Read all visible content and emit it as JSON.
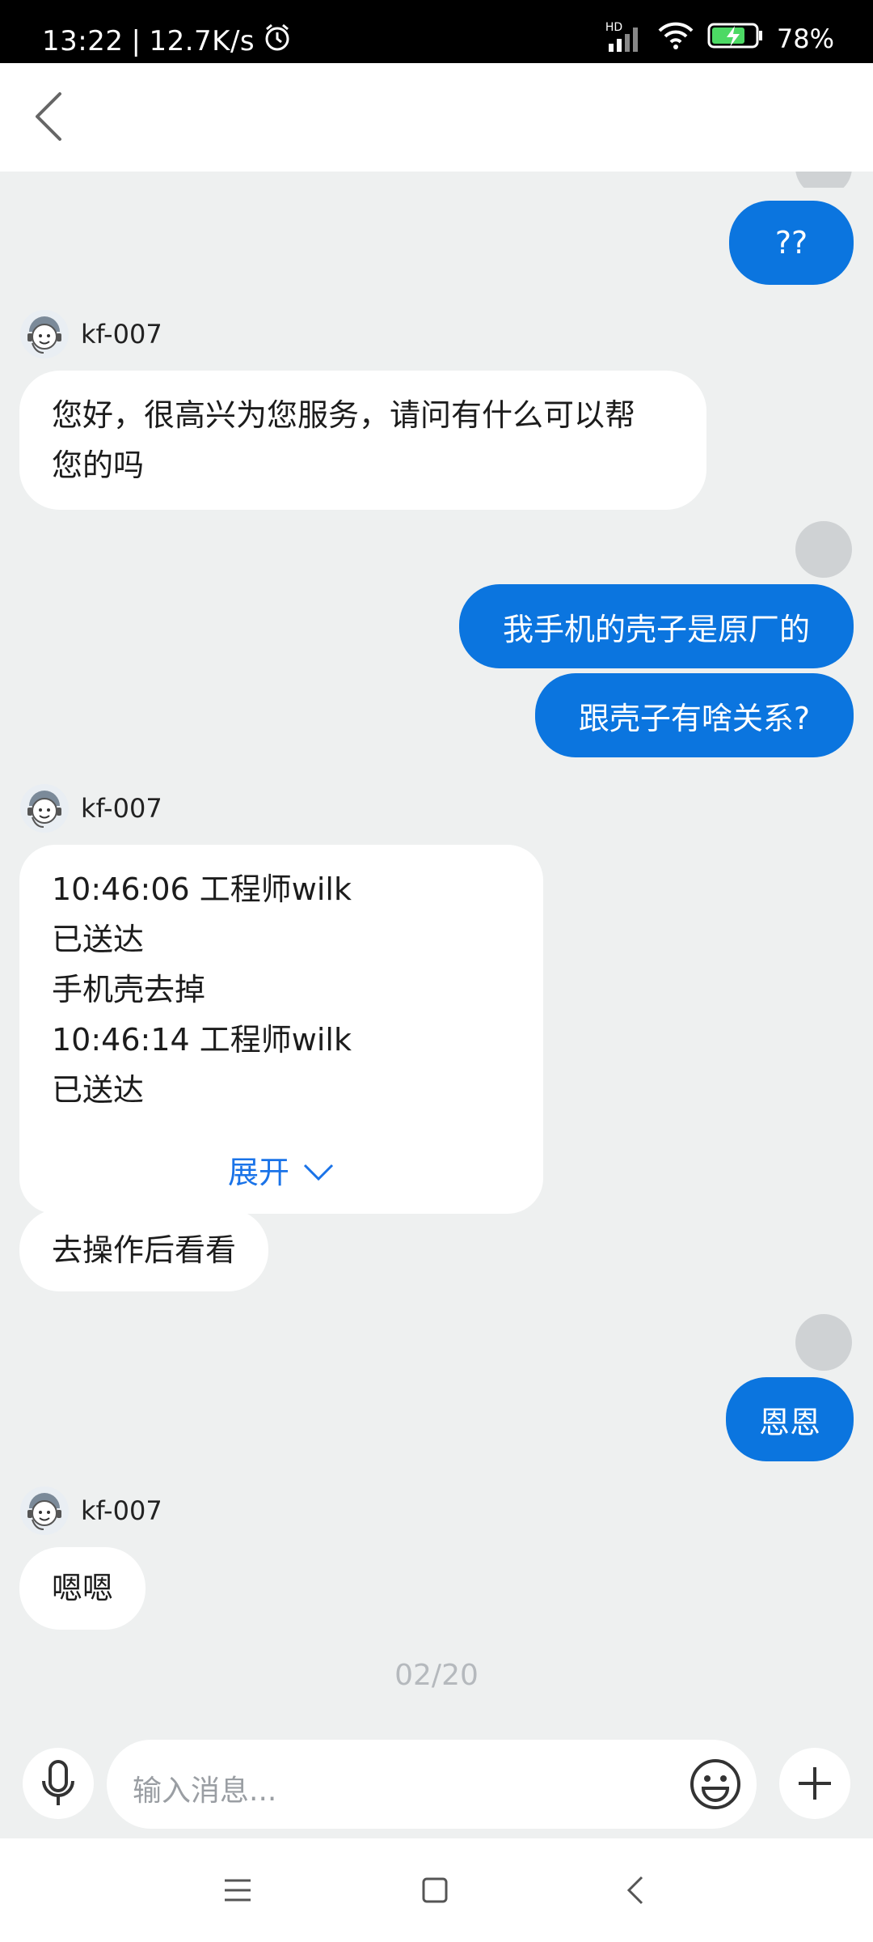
{
  "status_bar": {
    "time": "13:22",
    "separator": "|",
    "net_speed": "12.7K/s",
    "battery": "78%",
    "network_badge": "HD",
    "icons": [
      "alarm-icon",
      "signal-icon",
      "wifi-icon",
      "battery-charging-icon"
    ]
  },
  "header": {
    "back_icon": "chevron-left-icon"
  },
  "messages": [
    {
      "direction": "out",
      "text": "??"
    },
    {
      "direction": "in",
      "sender": "kf-007",
      "text": "您好，很高兴为您服务，请问有什么可以帮您的吗"
    },
    {
      "direction": "out",
      "text": "我手机的壳子是原厂的"
    },
    {
      "direction": "out",
      "text": "跟壳子有啥关系?"
    },
    {
      "direction": "in",
      "sender": "kf-007",
      "card_lines": [
        "10:46:06 工程师wilk",
        "已送达",
        "手机壳去掉",
        "10:46:14 工程师wilk",
        "已送达"
      ],
      "expand_label": "展开"
    },
    {
      "direction": "in",
      "text": "去操作后看看"
    },
    {
      "direction": "out",
      "text": "恩恩"
    },
    {
      "direction": "in",
      "sender": "kf-007",
      "text": "嗯嗯"
    }
  ],
  "message_lines": {
    "m1_line1": "您好，很高兴为您服务，请问有什么可以帮",
    "m1_line2": "您的吗"
  },
  "page_counter": "02/20",
  "input": {
    "placeholder": "输入消息..."
  },
  "colors": {
    "accent": "#0b75df",
    "link": "#1a73e8",
    "background": "#eef0f0"
  }
}
